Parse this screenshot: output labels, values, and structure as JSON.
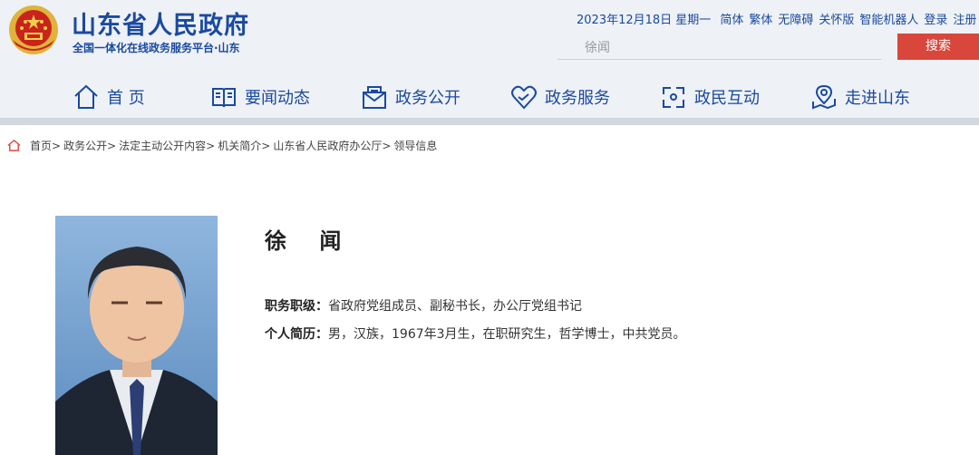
{
  "header": {
    "title": "山东省人民政府",
    "subtitle": "全国一体化在线政务服务平台·山东",
    "date": "2023年12月18日 星期一",
    "links": [
      "简体",
      "繁体",
      "无障碍",
      "关怀版",
      "智能机器人",
      "登录",
      "注册"
    ],
    "search_placeholder": "徐闻",
    "search_button": "搜索"
  },
  "nav": [
    {
      "label": "首 页",
      "icon": "home-icon"
    },
    {
      "label": "要闻动态",
      "icon": "news-book-icon"
    },
    {
      "label": "政务公开",
      "icon": "mail-icon"
    },
    {
      "label": "政务服务",
      "icon": "heart-hand-icon"
    },
    {
      "label": "政民互动",
      "icon": "interaction-icon"
    },
    {
      "label": "走进山东",
      "icon": "map-pin-icon"
    }
  ],
  "breadcrumb": [
    "首页",
    "政务公开",
    "法定主动公开内容",
    "机关简介",
    "山东省人民政府办公厅",
    "领导信息"
  ],
  "profile": {
    "name": "徐 闻",
    "position_label": "职务职级：",
    "position": "省政府党组成员、副秘书长，办公厅党组书记",
    "bio_label": "个人简历：",
    "bio": "男，汉族，1967年3月生，在职研究生，哲学博士，中共党员。"
  },
  "colors": {
    "brand_blue": "#1a4aa0",
    "search_red": "#d9473c",
    "header_bg": "#eef1f6"
  }
}
